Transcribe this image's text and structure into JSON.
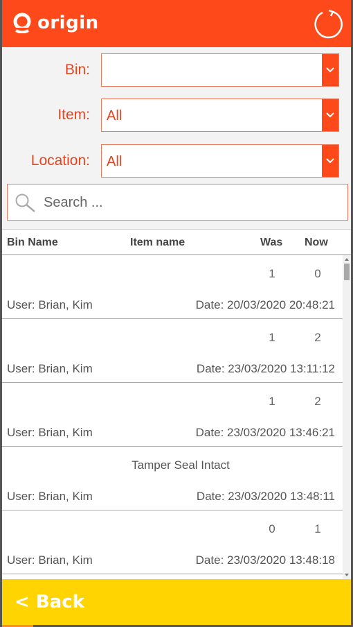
{
  "header": {
    "logo_text": "origin",
    "brand_color": "#fe4a1a",
    "refresh_icon": "refresh-icon"
  },
  "filters": {
    "bin": {
      "label": "Bin:",
      "value": ""
    },
    "item": {
      "label": "Item:",
      "value": "All"
    },
    "location": {
      "label": "Location:",
      "value": "All"
    },
    "search": {
      "placeholder": "Search ...",
      "icon": "search-icon"
    }
  },
  "table": {
    "headers": {
      "bin_name": "Bin Name",
      "item_name": "Item name",
      "was": "Was",
      "now": "Now"
    },
    "rows": [
      {
        "was": "1",
        "now": "0",
        "note": "",
        "user": "User: Brian, Kim",
        "date": "Date: 20/03/2020 20:48:21"
      },
      {
        "was": "1",
        "now": "2",
        "note": "",
        "user": "User: Brian, Kim",
        "date": "Date: 23/03/2020 13:11:12"
      },
      {
        "was": "1",
        "now": "2",
        "note": "",
        "user": "User: Brian, Kim",
        "date": "Date: 23/03/2020 13:46:21"
      },
      {
        "was": "",
        "now": "",
        "note": "Tamper Seal Intact",
        "user": "User: Brian, Kim",
        "date": "Date: 23/03/2020 13:48:11"
      },
      {
        "was": "0",
        "now": "1",
        "note": "",
        "user": "User: Brian, Kim",
        "date": "Date: 23/03/2020 13:48:18"
      }
    ]
  },
  "footer": {
    "back_label": "< Back",
    "color": "#ffd400"
  }
}
